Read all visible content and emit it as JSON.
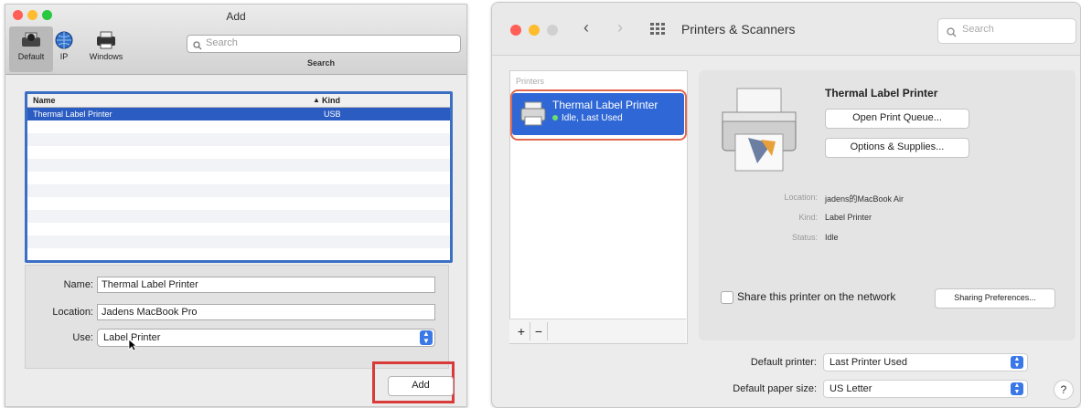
{
  "add_window": {
    "title": "Add",
    "toolbar": [
      {
        "label": "Default",
        "icon": "default-printer-icon"
      },
      {
        "label": "IP",
        "icon": "globe-icon"
      },
      {
        "label": "Windows",
        "icon": "windows-printer-icon"
      }
    ],
    "search": {
      "placeholder": "Search",
      "label": "Search"
    },
    "list": {
      "columns": [
        "Name",
        "Kind"
      ],
      "rows": [
        {
          "name": "Thermal Label Printer",
          "kind": "USB"
        }
      ]
    },
    "form": {
      "name_label": "Name:",
      "name_value": "Thermal Label Printer",
      "location_label": "Location:",
      "location_value": "Jadens MacBook Pro",
      "use_label": "Use:",
      "use_value": "Label Printer"
    },
    "add_button": "Add",
    "highlight_color": "#d93a3a"
  },
  "prefs_window": {
    "title": "Printers & Scanners",
    "search_placeholder": "Search",
    "printers_header": "Printers",
    "selected_printer": {
      "name": "Thermal Label Printer",
      "status": "Idle, Last Used"
    },
    "detail": {
      "name": "Thermal Label Printer",
      "open_queue": "Open Print Queue...",
      "options": "Options & Supplies...",
      "location_key": "Location:",
      "location_val": "jadens的MacBook Air",
      "kind_key": "Kind:",
      "kind_val": "Label Printer",
      "status_key": "Status:",
      "status_val": "Idle",
      "share_label": "Share this printer on the network",
      "sharing_prefs": "Sharing Preferences..."
    },
    "default_printer_label": "Default printer:",
    "default_printer_value": "Last Printer Used",
    "paper_size_label": "Default paper size:",
    "paper_size_value": "US Letter",
    "help": "?",
    "plus": "+",
    "minus": "−",
    "accent_color": "#2f68d6",
    "highlight_color": "#e0684e"
  }
}
